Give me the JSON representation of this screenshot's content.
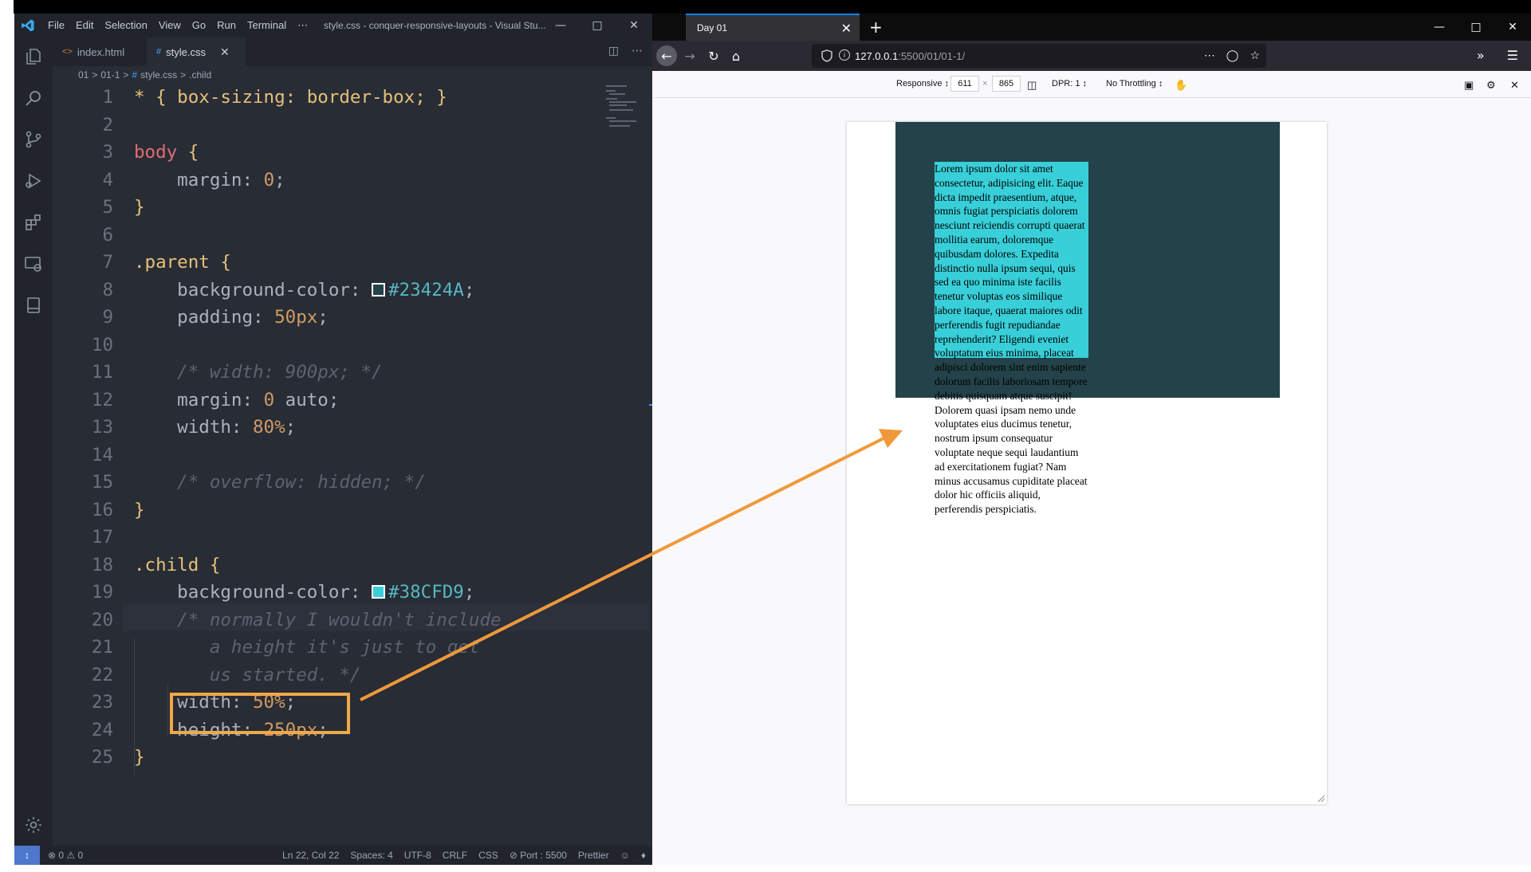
{
  "vscode": {
    "menu": [
      "File",
      "Edit",
      "Selection",
      "View",
      "Go",
      "Run",
      "Terminal",
      "⋯"
    ],
    "window_title": "style.css - conquer-responsive-layouts - Visual Stu...",
    "tabs": [
      {
        "icon": "<>",
        "label": "index.html",
        "active": false
      },
      {
        "icon": "#",
        "label": "style.css",
        "active": true
      }
    ],
    "breadcrumb": [
      "01",
      ">",
      "01-1",
      ">",
      "#",
      "style.css",
      ">",
      ".child"
    ],
    "code": [
      {
        "n": "1"
      },
      {
        "n": "2"
      },
      {
        "n": "3"
      },
      {
        "n": "4"
      },
      {
        "n": "5"
      },
      {
        "n": "6"
      },
      {
        "n": "7"
      },
      {
        "n": "8"
      },
      {
        "n": "9"
      },
      {
        "n": "10"
      },
      {
        "n": "11"
      },
      {
        "n": "12"
      },
      {
        "n": "13"
      },
      {
        "n": "14"
      },
      {
        "n": "15"
      },
      {
        "n": "16"
      },
      {
        "n": "17"
      },
      {
        "n": "18"
      },
      {
        "n": "19"
      },
      {
        "n": "20"
      },
      {
        "n": "21"
      },
      {
        "n": "22"
      },
      {
        "n": "23"
      },
      {
        "n": "24"
      },
      {
        "n": "25"
      }
    ],
    "code_text": {
      "l1_star": "*",
      "l1_rest": " { box-sizing: border-box; }",
      "l3_sel": "body",
      "l3_brace": " {",
      "l4_prop": "    margin: ",
      "l4_val": "0",
      "l4_semi": ";",
      "l5": "}",
      "l7_sel": ".parent",
      "l7_brace": " {",
      "l8_prop": "    background-color: ",
      "l8_val": "#23424A",
      "l8_semi": ";",
      "l9_prop": "    padding: ",
      "l9_val": "50px",
      "l9_semi": ";",
      "l11": "    /* width: 900px; */",
      "l12_prop": "    margin: ",
      "l12_val": "0",
      "l12_rest": " auto;",
      "l13_prop": "    width: ",
      "l13_val": "80%",
      "l13_semi": ";",
      "l15": "    /* overflow: hidden; */",
      "l16": "}",
      "l18_sel": ".child",
      "l18_brace": " {",
      "l19_prop": "    background-color: ",
      "l19_val": "#38CFD9",
      "l19_semi": ";",
      "l20": "    /* normally I wouldn't include",
      "l21": "       a height it's just to get",
      "l22": "       us started. */",
      "l23_prop": "    width: ",
      "l23_val": "50%",
      "l23_semi": ";",
      "l24_prop": "    height: ",
      "l24_val": "250px",
      "l24_semi": ";",
      "l25": "}"
    },
    "status": {
      "problems": "⊗ 0 ⚠ 0",
      "position": "Ln 22, Col 22",
      "spaces": "Spaces: 4",
      "encoding": "UTF-8",
      "eol": "CRLF",
      "language": "CSS",
      "port": "⊘ Port : 5500",
      "formatter": "Prettier"
    },
    "colors": {
      "parent_swatch": "#23424A",
      "child_swatch": "#38CFD9",
      "highlight": "#f0a848"
    }
  },
  "firefox": {
    "tab_title": "Day 01",
    "url_host": "127.0.0.1",
    "url_rest": ":5500/01/01-1/",
    "rdm": {
      "device": "Responsive ↕",
      "width": "611",
      "times": "×",
      "height": "865",
      "dpr": "DPR: 1 ↕",
      "throttle": "No Throttling ↕"
    },
    "page": {
      "lorem": "Lorem ipsum dolor sit amet consectetur, adipisicing elit. Eaque dicta impedit praesentium, atque, omnis fugiat perspiciatis dolorem nesciunt reiciendis corrupti quaerat mollitia earum, doloremque quibusdam dolores. Expedita distinctio nulla ipsum sequi, quis sed ea quo minima iste facilis tenetur voluptas eos similique labore itaque, quaerat maiores odit perferendis fugit repudiandae reprehenderit? Eligendi eveniet voluptatum eius minima, placeat adipisci dolorem sint enim sapiente dolorum facilis laboriosam tempore debitis quisquam atque suscipit! Dolorem quasi ipsam nemo unde voluptates eius ducimus tenetur, nostrum ipsum consequatur voluptate neque sequi laudantium ad exercitationem fugiat? Nam minus accusamus cupiditate placeat dolor hic officiis aliquid, perferendis perspiciatis."
    },
    "colors": {
      "parent_bg": "#23424A",
      "child_bg": "#38CFD9",
      "arrow": "#f0993a"
    }
  }
}
